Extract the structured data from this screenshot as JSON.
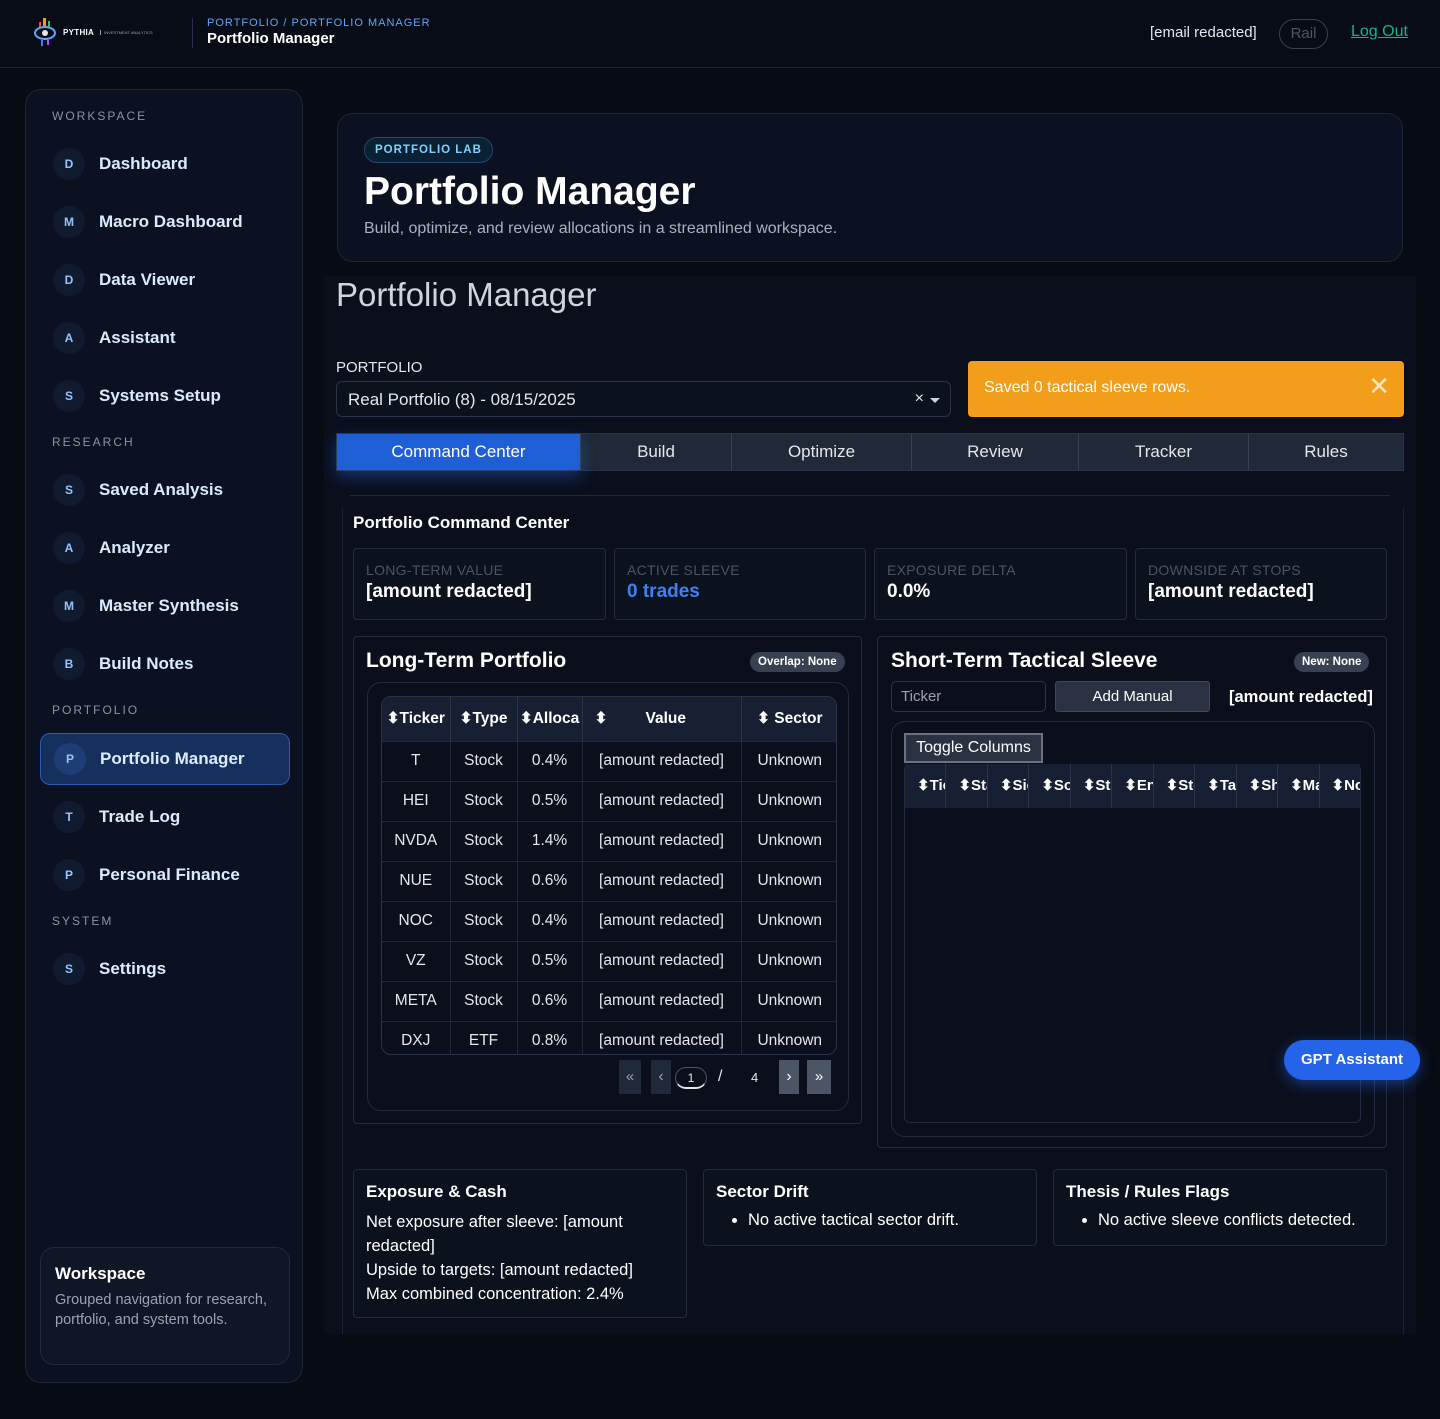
{
  "topbar": {
    "logo_text": "PYTHIA",
    "logo_sub": "INVESTMENT ANALYTICS",
    "breadcrumb": "PORTFOLIO / PORTFOLIO MANAGER",
    "title": "Portfolio Manager",
    "email": "[email redacted]",
    "rail_label": "Rail",
    "logout_label": "Log Out"
  },
  "sidebar": {
    "sections": [
      {
        "label": "WORKSPACE"
      },
      {
        "label": "RESEARCH"
      },
      {
        "label": "PORTFOLIO"
      },
      {
        "label": "SYSTEM"
      }
    ],
    "items": [
      {
        "badge": "D",
        "label": "Dashboard"
      },
      {
        "badge": "M",
        "label": "Macro Dashboard"
      },
      {
        "badge": "D",
        "label": "Data Viewer"
      },
      {
        "badge": "A",
        "label": "Assistant"
      },
      {
        "badge": "S",
        "label": "Systems Setup"
      },
      {
        "badge": "S",
        "label": "Saved Analysis"
      },
      {
        "badge": "A",
        "label": "Analyzer"
      },
      {
        "badge": "M",
        "label": "Master Synthesis"
      },
      {
        "badge": "B",
        "label": "Build Notes"
      },
      {
        "badge": "P",
        "label": "Portfolio Manager",
        "active": true
      },
      {
        "badge": "T",
        "label": "Trade Log"
      },
      {
        "badge": "P",
        "label": "Personal Finance"
      },
      {
        "badge": "S",
        "label": "Settings"
      }
    ],
    "card": {
      "title": "Workspace",
      "text": "Grouped navigation for research, portfolio, and system tools."
    }
  },
  "hero": {
    "pill": "PORTFOLIO LAB",
    "title": "Portfolio Manager",
    "subtitle": "Build, optimize, and review allocations in a streamlined workspace."
  },
  "main": {
    "title": "Portfolio Manager",
    "portfolio_label": "PORTFOLIO",
    "portfolio_value": "Real Portfolio (8) - 08/15/2025",
    "clear_symbol": "×",
    "toast": "Saved 0 tactical sleeve rows.",
    "toast_close": "✕",
    "tabs": [
      "Command Center",
      "Build",
      "Optimize",
      "Review",
      "Tracker",
      "Rules"
    ],
    "active_tab": "Command Center"
  },
  "command_center": {
    "title": "Portfolio Command Center",
    "kpis": [
      {
        "label": "LONG-TERM VALUE",
        "value": "[amount redacted]"
      },
      {
        "label": "ACTIVE SLEEVE",
        "value": "0 trades"
      },
      {
        "label": "EXPOSURE DELTA",
        "value": "0.0%"
      },
      {
        "label": "DOWNSIDE AT STOPS",
        "value": "[amount redacted]"
      }
    ]
  },
  "long_term": {
    "title": "Long-Term Portfolio",
    "tag": "Overlap: None",
    "columns": [
      "⬍Ticker",
      "⬍Type",
      "⬍Alloca",
      "⬍",
      "Value",
      "⬍ Sector"
    ],
    "rows": [
      [
        "T",
        "Stock",
        "0.4%",
        "[amount redacted]",
        "Unknown"
      ],
      [
        "HEI",
        "Stock",
        "0.5%",
        "[amount redacted]",
        "Unknown"
      ],
      [
        "NVDA",
        "Stock",
        "1.4%",
        "[amount redacted]",
        "Unknown"
      ],
      [
        "NUE",
        "Stock",
        "0.6%",
        "[amount redacted]",
        "Unknown"
      ],
      [
        "NOC",
        "Stock",
        "0.4%",
        "[amount redacted]",
        "Unknown"
      ],
      [
        "VZ",
        "Stock",
        "0.5%",
        "[amount redacted]",
        "Unknown"
      ],
      [
        "META",
        "Stock",
        "0.6%",
        "[amount redacted]",
        "Unknown"
      ],
      [
        "DXJ",
        "ETF",
        "0.8%",
        "[amount redacted]",
        "Unknown"
      ]
    ],
    "pager": {
      "first": "«",
      "prev": "‹",
      "page": "1",
      "sep": "/",
      "total": "4",
      "next": "›",
      "last": "»"
    }
  },
  "short_term": {
    "title": "Short-Term Tactical Sleeve",
    "tag": "New: None",
    "ticker_placeholder": "Ticker",
    "add_label": "Add Manual",
    "amount": "[amount redacted]",
    "toggle_label": "Toggle Columns",
    "columns": [
      "⬍Tic",
      "⬍Sta",
      "⬍Sic",
      "⬍So",
      "⬍Str",
      "⬍En",
      "⬍Sto",
      "⬍Ta",
      "⬍Sh",
      "⬍Ma",
      "⬍No"
    ]
  },
  "gpt_button": "GPT Assistant",
  "cards": {
    "exposure": {
      "title": "Exposure & Cash",
      "lines": [
        "Net exposure after sleeve: [amount redacted]",
        "Upside to targets: [amount redacted]",
        "Max combined concentration: 2.4%"
      ]
    },
    "sector": {
      "title": "Sector Drift",
      "items": [
        "No active tactical sector drift."
      ]
    },
    "thesis": {
      "title": "Thesis / Rules Flags",
      "items": [
        "No active sleeve conflicts detected."
      ]
    }
  },
  "colors": {
    "accent": "#1f5fd6",
    "toast": "#f29e1b",
    "success": "#10b981"
  }
}
